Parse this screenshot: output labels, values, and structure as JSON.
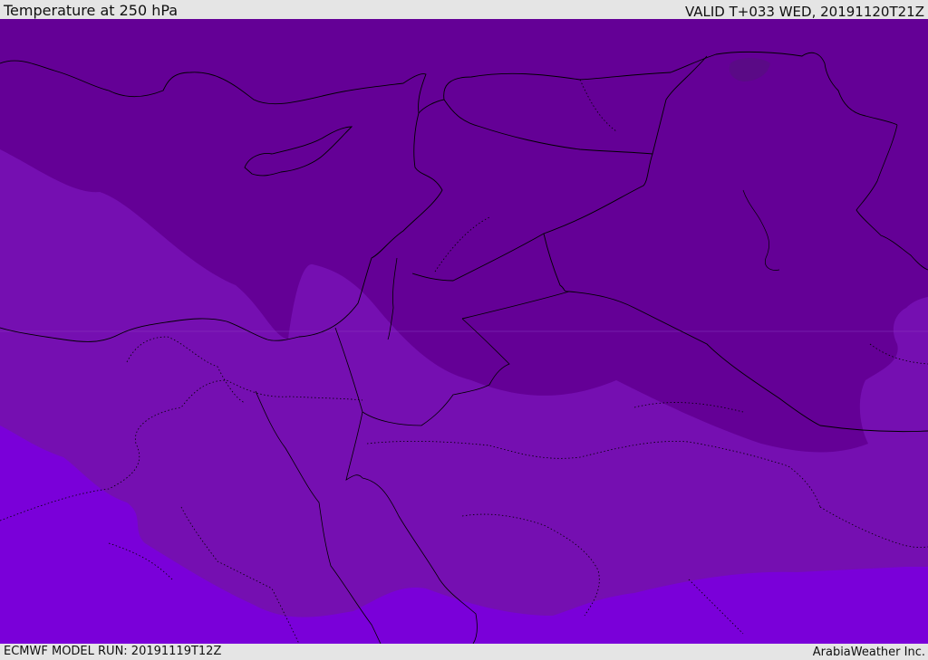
{
  "header": {
    "title": "Temperature at 250 hPa",
    "valid_time": "VALID T+033 WED, 20191120T21Z"
  },
  "footer": {
    "model_run": "ECMWF MODEL RUN: 20191119T12Z",
    "credit": "ArabiaWeather Inc."
  },
  "colors": {
    "bar_background": "#e5e5e5",
    "band_coldest": "#640096",
    "band_mid": "#750fb1",
    "band_warmest": "#7a00d9",
    "cold_pocket": "#5a0a86",
    "coastline": "#000000"
  }
}
